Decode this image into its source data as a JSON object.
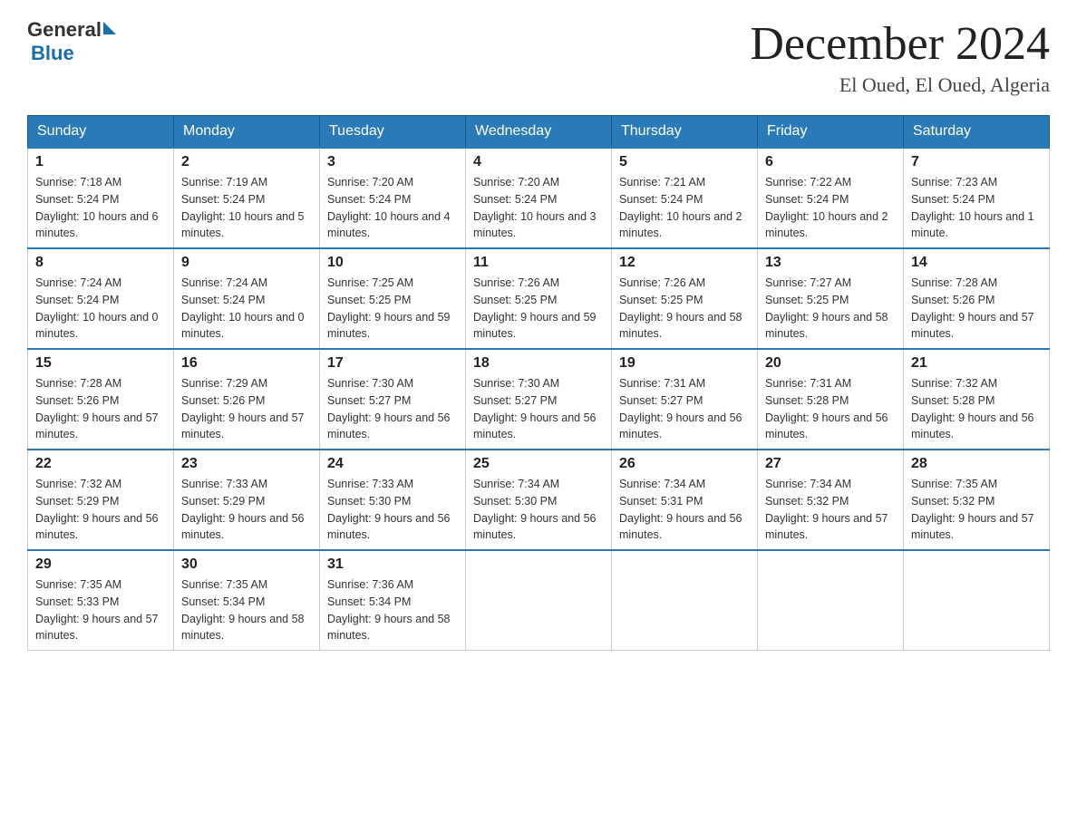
{
  "header": {
    "logo_general": "General",
    "logo_blue": "Blue",
    "month_title": "December 2024",
    "location": "El Oued, El Oued, Algeria"
  },
  "days_of_week": [
    "Sunday",
    "Monday",
    "Tuesday",
    "Wednesday",
    "Thursday",
    "Friday",
    "Saturday"
  ],
  "weeks": [
    [
      {
        "day": "1",
        "sunrise": "7:18 AM",
        "sunset": "5:24 PM",
        "daylight": "10 hours and 6 minutes."
      },
      {
        "day": "2",
        "sunrise": "7:19 AM",
        "sunset": "5:24 PM",
        "daylight": "10 hours and 5 minutes."
      },
      {
        "day": "3",
        "sunrise": "7:20 AM",
        "sunset": "5:24 PM",
        "daylight": "10 hours and 4 minutes."
      },
      {
        "day": "4",
        "sunrise": "7:20 AM",
        "sunset": "5:24 PM",
        "daylight": "10 hours and 3 minutes."
      },
      {
        "day": "5",
        "sunrise": "7:21 AM",
        "sunset": "5:24 PM",
        "daylight": "10 hours and 2 minutes."
      },
      {
        "day": "6",
        "sunrise": "7:22 AM",
        "sunset": "5:24 PM",
        "daylight": "10 hours and 2 minutes."
      },
      {
        "day": "7",
        "sunrise": "7:23 AM",
        "sunset": "5:24 PM",
        "daylight": "10 hours and 1 minute."
      }
    ],
    [
      {
        "day": "8",
        "sunrise": "7:24 AM",
        "sunset": "5:24 PM",
        "daylight": "10 hours and 0 minutes."
      },
      {
        "day": "9",
        "sunrise": "7:24 AM",
        "sunset": "5:24 PM",
        "daylight": "10 hours and 0 minutes."
      },
      {
        "day": "10",
        "sunrise": "7:25 AM",
        "sunset": "5:25 PM",
        "daylight": "9 hours and 59 minutes."
      },
      {
        "day": "11",
        "sunrise": "7:26 AM",
        "sunset": "5:25 PM",
        "daylight": "9 hours and 59 minutes."
      },
      {
        "day": "12",
        "sunrise": "7:26 AM",
        "sunset": "5:25 PM",
        "daylight": "9 hours and 58 minutes."
      },
      {
        "day": "13",
        "sunrise": "7:27 AM",
        "sunset": "5:25 PM",
        "daylight": "9 hours and 58 minutes."
      },
      {
        "day": "14",
        "sunrise": "7:28 AM",
        "sunset": "5:26 PM",
        "daylight": "9 hours and 57 minutes."
      }
    ],
    [
      {
        "day": "15",
        "sunrise": "7:28 AM",
        "sunset": "5:26 PM",
        "daylight": "9 hours and 57 minutes."
      },
      {
        "day": "16",
        "sunrise": "7:29 AM",
        "sunset": "5:26 PM",
        "daylight": "9 hours and 57 minutes."
      },
      {
        "day": "17",
        "sunrise": "7:30 AM",
        "sunset": "5:27 PM",
        "daylight": "9 hours and 56 minutes."
      },
      {
        "day": "18",
        "sunrise": "7:30 AM",
        "sunset": "5:27 PM",
        "daylight": "9 hours and 56 minutes."
      },
      {
        "day": "19",
        "sunrise": "7:31 AM",
        "sunset": "5:27 PM",
        "daylight": "9 hours and 56 minutes."
      },
      {
        "day": "20",
        "sunrise": "7:31 AM",
        "sunset": "5:28 PM",
        "daylight": "9 hours and 56 minutes."
      },
      {
        "day": "21",
        "sunrise": "7:32 AM",
        "sunset": "5:28 PM",
        "daylight": "9 hours and 56 minutes."
      }
    ],
    [
      {
        "day": "22",
        "sunrise": "7:32 AM",
        "sunset": "5:29 PM",
        "daylight": "9 hours and 56 minutes."
      },
      {
        "day": "23",
        "sunrise": "7:33 AM",
        "sunset": "5:29 PM",
        "daylight": "9 hours and 56 minutes."
      },
      {
        "day": "24",
        "sunrise": "7:33 AM",
        "sunset": "5:30 PM",
        "daylight": "9 hours and 56 minutes."
      },
      {
        "day": "25",
        "sunrise": "7:34 AM",
        "sunset": "5:30 PM",
        "daylight": "9 hours and 56 minutes."
      },
      {
        "day": "26",
        "sunrise": "7:34 AM",
        "sunset": "5:31 PM",
        "daylight": "9 hours and 56 minutes."
      },
      {
        "day": "27",
        "sunrise": "7:34 AM",
        "sunset": "5:32 PM",
        "daylight": "9 hours and 57 minutes."
      },
      {
        "day": "28",
        "sunrise": "7:35 AM",
        "sunset": "5:32 PM",
        "daylight": "9 hours and 57 minutes."
      }
    ],
    [
      {
        "day": "29",
        "sunrise": "7:35 AM",
        "sunset": "5:33 PM",
        "daylight": "9 hours and 57 minutes."
      },
      {
        "day": "30",
        "sunrise": "7:35 AM",
        "sunset": "5:34 PM",
        "daylight": "9 hours and 58 minutes."
      },
      {
        "day": "31",
        "sunrise": "7:36 AM",
        "sunset": "5:34 PM",
        "daylight": "9 hours and 58 minutes."
      },
      null,
      null,
      null,
      null
    ]
  ],
  "labels": {
    "sunrise": "Sunrise:",
    "sunset": "Sunset:",
    "daylight": "Daylight:"
  }
}
